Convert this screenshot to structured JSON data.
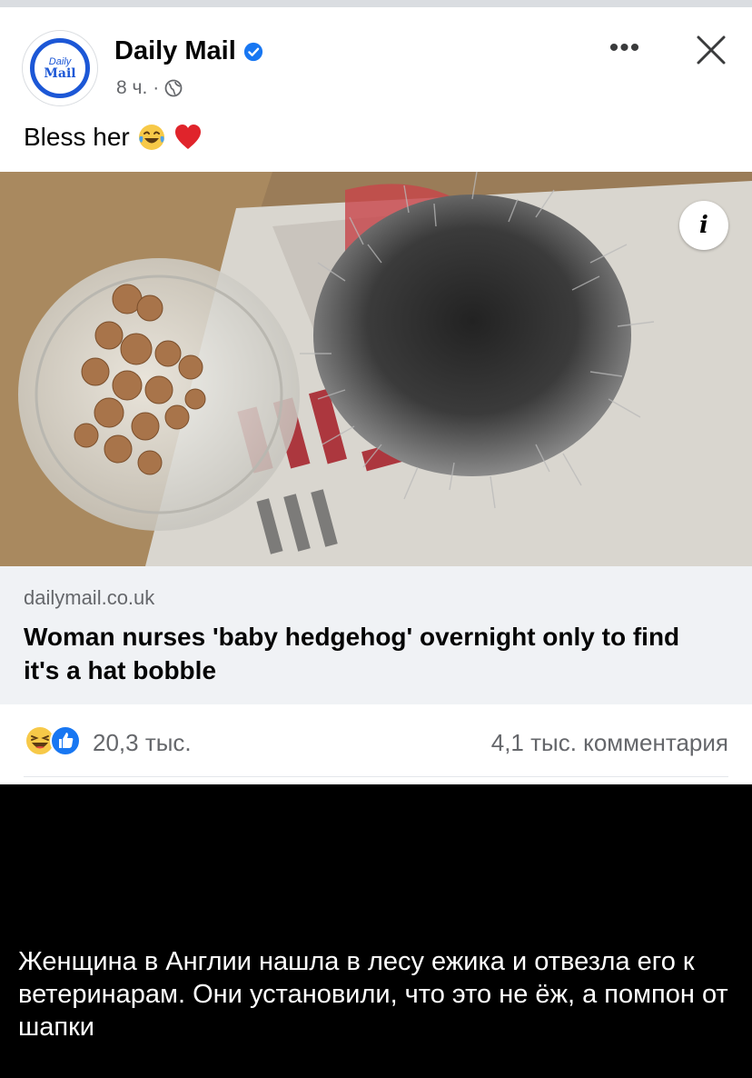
{
  "post": {
    "page_name": "Daily Mail",
    "avatar_text_1": "Daily",
    "avatar_text_2": "Mail",
    "time": "8 ч.",
    "time_separator": "·",
    "more_label": "•••",
    "text": "Bless her",
    "emojis": [
      "tears-of-joy-icon",
      "red-heart-icon"
    ]
  },
  "image": {
    "description_icons": [
      "paper-bowl-icon",
      "fur-bobble-icon",
      "newspaper-icon"
    ],
    "info_label": "i"
  },
  "link": {
    "domain": "dailymail.co.uk",
    "headline": "Woman nurses 'baby hedgehog' overnight only to find it's a hat bobble"
  },
  "engagement": {
    "reaction_icons": [
      "laughing-reaction-icon",
      "like-reaction-icon"
    ],
    "reaction_count": "20,3 тыс.",
    "comments": "4,1 тыс. комментария"
  },
  "caption": {
    "text": "Женщина в Англии нашла в лесу ежика и отвезла его к ветеринарам. Они установили, что это не ёж, а помпон от шапки"
  },
  "colors": {
    "brand": "#1c57d6",
    "verified": "#1877f2",
    "secondary_text": "#65676b",
    "link_bg": "#f0f2f5",
    "caption_bg": "#000000"
  }
}
